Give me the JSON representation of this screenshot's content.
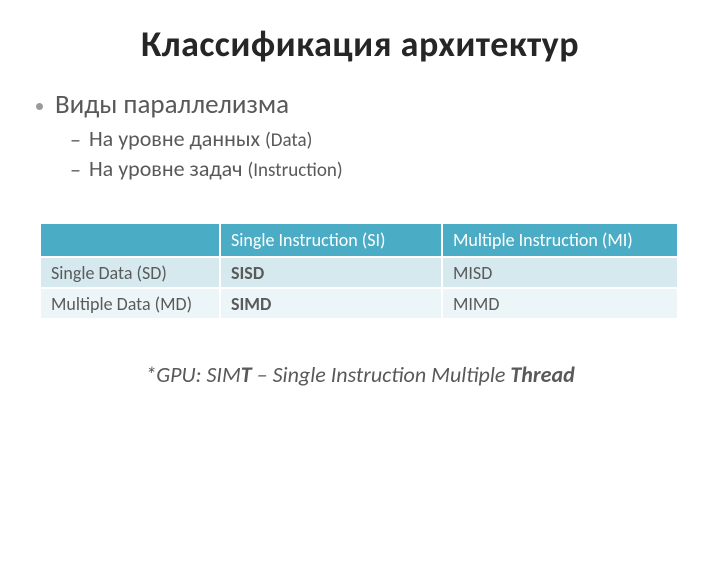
{
  "title": "Классификация архитектур",
  "bullets": {
    "main": "Виды параллелизма",
    "subs": [
      {
        "text": "На уровне данных ",
        "paren": "(Data)"
      },
      {
        "text": "На уровне задач ",
        "paren": "(Instruction)"
      }
    ]
  },
  "table": {
    "headers": [
      "",
      "Single Instruction (SI)",
      "Multiple Instruction (MI)"
    ],
    "rows": [
      {
        "label": "Single Data (SD)",
        "c1": "SISD",
        "c2": "MISD",
        "bold": "c1"
      },
      {
        "label": "Multiple Data (MD)",
        "c1": "SIMD",
        "c2": "MIMD",
        "bold": "c1"
      }
    ]
  },
  "footnote": {
    "prefix": "*GPU: SIM",
    "boldT": "T",
    "mid": " – Single Instruction Multiple ",
    "boldThread": "Thread"
  },
  "chart_data": {
    "type": "table",
    "title": "Классификация архитектур (Flynn taxonomy)",
    "columns": [
      "",
      "Single Instruction (SI)",
      "Multiple Instruction (MI)"
    ],
    "rows": [
      [
        "Single Data (SD)",
        "SISD",
        "MISD"
      ],
      [
        "Multiple Data (MD)",
        "SIMD",
        "MIMD"
      ]
    ]
  }
}
